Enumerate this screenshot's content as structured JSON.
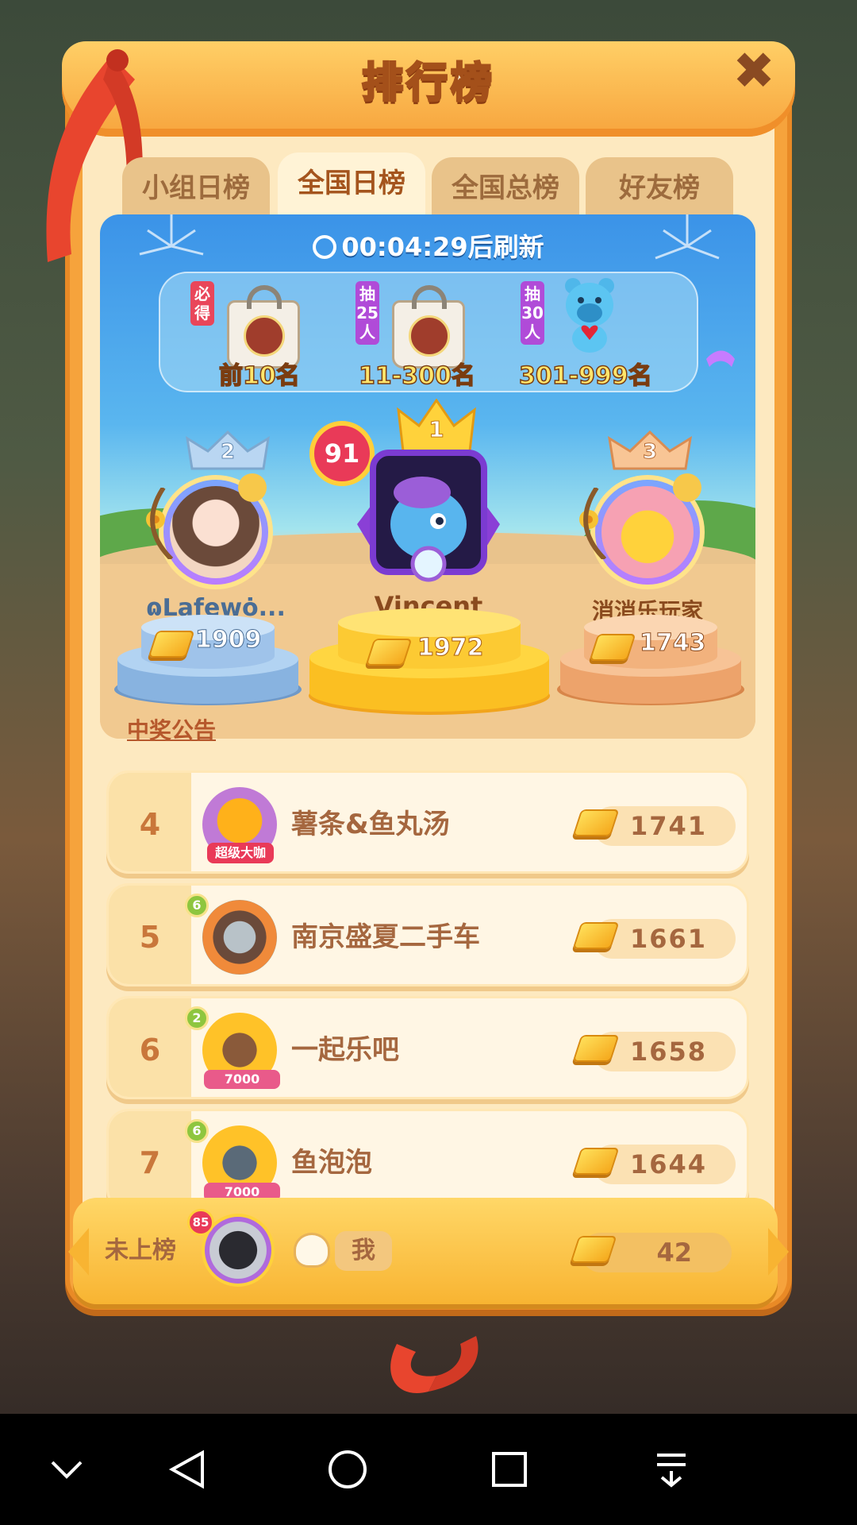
{
  "dialog": {
    "title": "排行榜",
    "close_label": "✖"
  },
  "tabs": [
    {
      "label": "小组日榜",
      "active": false
    },
    {
      "label": "全国日榜",
      "active": true
    },
    {
      "label": "全国总榜",
      "active": false
    },
    {
      "label": "好友榜",
      "active": false
    }
  ],
  "timer": {
    "text": "00:04:29后刷新"
  },
  "prizes": [
    {
      "tag": "必得",
      "range": "前10名",
      "tag_color": "#e9465a"
    },
    {
      "tag": "抽25人",
      "range": "11-300名",
      "tag_color": "#b04bd8"
    },
    {
      "tag": "抽30人",
      "range": "301-999名",
      "tag_color": "#b04bd8"
    }
  ],
  "podium": {
    "first": {
      "rank": "1",
      "level": "91",
      "name": "Vincent",
      "score": "1972"
    },
    "second": {
      "rank": "2",
      "name": "ɷꓡafewȯ...",
      "score": "1909"
    },
    "third": {
      "rank": "3",
      "name": "消消乐玩家",
      "score": "1743"
    }
  },
  "notice": "中奖公告",
  "rankings": [
    {
      "rank": "4",
      "name": "薯条&鱼丸汤",
      "score": "1741",
      "badge": "超级大咖"
    },
    {
      "rank": "5",
      "name": "南京盛夏二手车",
      "score": "1661",
      "level": "6"
    },
    {
      "rank": "6",
      "name": "一起乐吧",
      "score": "1658",
      "level": "2",
      "badge": "7000"
    },
    {
      "rank": "7",
      "name": "鱼泡泡",
      "score": "1644",
      "level": "6",
      "badge": "7000"
    }
  ],
  "me": {
    "status": "未上榜",
    "level": "85",
    "name": "我",
    "score": "42"
  },
  "colors": {
    "panel": "#f6a33c",
    "inner": "#fde9c0",
    "accent": "#a4541d"
  }
}
